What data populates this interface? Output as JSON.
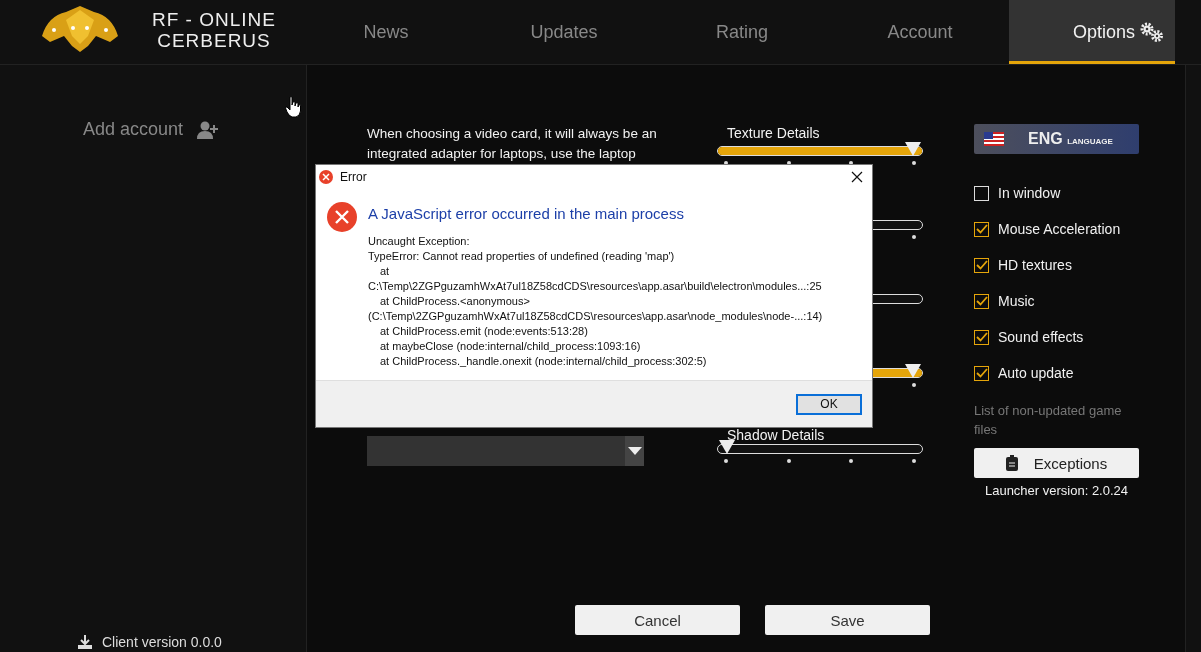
{
  "header": {
    "brand_lines": [
      "RF - ONLINE",
      "CERBERUS"
    ],
    "tabs": [
      {
        "label": "News",
        "selected": false
      },
      {
        "label": "Updates",
        "selected": false
      },
      {
        "label": "Rating",
        "selected": false
      },
      {
        "label": "Account",
        "selected": false
      },
      {
        "label": "Options",
        "selected": true
      }
    ]
  },
  "sidebar": {
    "add_account": "Add account",
    "client_version": "Client version 0.0.0"
  },
  "options": {
    "video_card_note": "When choosing a video card, it will always be an integrated adapter for laptops, use the laptop",
    "sliders": [
      {
        "label": "Texture Details",
        "level": 1,
        "ticks": true
      },
      {
        "ticks": true
      },
      {
        "ticks": false
      },
      {
        "level": 1,
        "ticks": true
      },
      {
        "label": "Shadow Details",
        "level": 0,
        "ticks": true
      }
    ],
    "language": {
      "code": "ENG",
      "caption": "LANGUAGE"
    },
    "checkboxes": [
      {
        "label": "In window",
        "checked": false
      },
      {
        "label": "Mouse Acceleration",
        "checked": true
      },
      {
        "label": "HD textures",
        "checked": true
      },
      {
        "label": "Music",
        "checked": true
      },
      {
        "label": "Sound effects",
        "checked": true
      },
      {
        "label": "Auto update",
        "checked": true
      }
    ],
    "exceptions_note": "List of non-updated game files",
    "exceptions_button": "Exceptions",
    "launcher_version": "Launcher version: 2.0.24",
    "buttons": [
      "Cancel",
      "Save"
    ]
  },
  "dialog": {
    "title": "Error",
    "heading": "A JavaScript error occurred in the main process",
    "lines": [
      {
        "kind": "plain",
        "text": "Uncaught Exception:"
      },
      {
        "kind": "plain",
        "text": "TypeError: Cannot read properties of undefined (reading 'map')"
      },
      {
        "kind": "frame",
        "text": "at"
      },
      {
        "kind": "plain",
        "text": "C:\\Temp\\2ZGPguzamhWxAt7ul18Z58cdCDS\\resources\\app.asar\\build\\electron\\modules...:25"
      },
      {
        "kind": "frame",
        "text": "at ChildProcess.<anonymous>"
      },
      {
        "kind": "plain",
        "text": "(C:\\Temp\\2ZGPguzamhWxAt7ul18Z58cdCDS\\resources\\app.asar\\node_modules\\node-...:14)"
      },
      {
        "kind": "frame",
        "text": "at ChildProcess.emit (node:events:513:28)"
      },
      {
        "kind": "frame",
        "text": "at maybeClose (node:internal/child_process:1093:16)"
      },
      {
        "kind": "frame",
        "text": "at ChildProcess._handle.onexit (node:internal/child_process:302:5)"
      }
    ],
    "ok_button": "OK"
  }
}
